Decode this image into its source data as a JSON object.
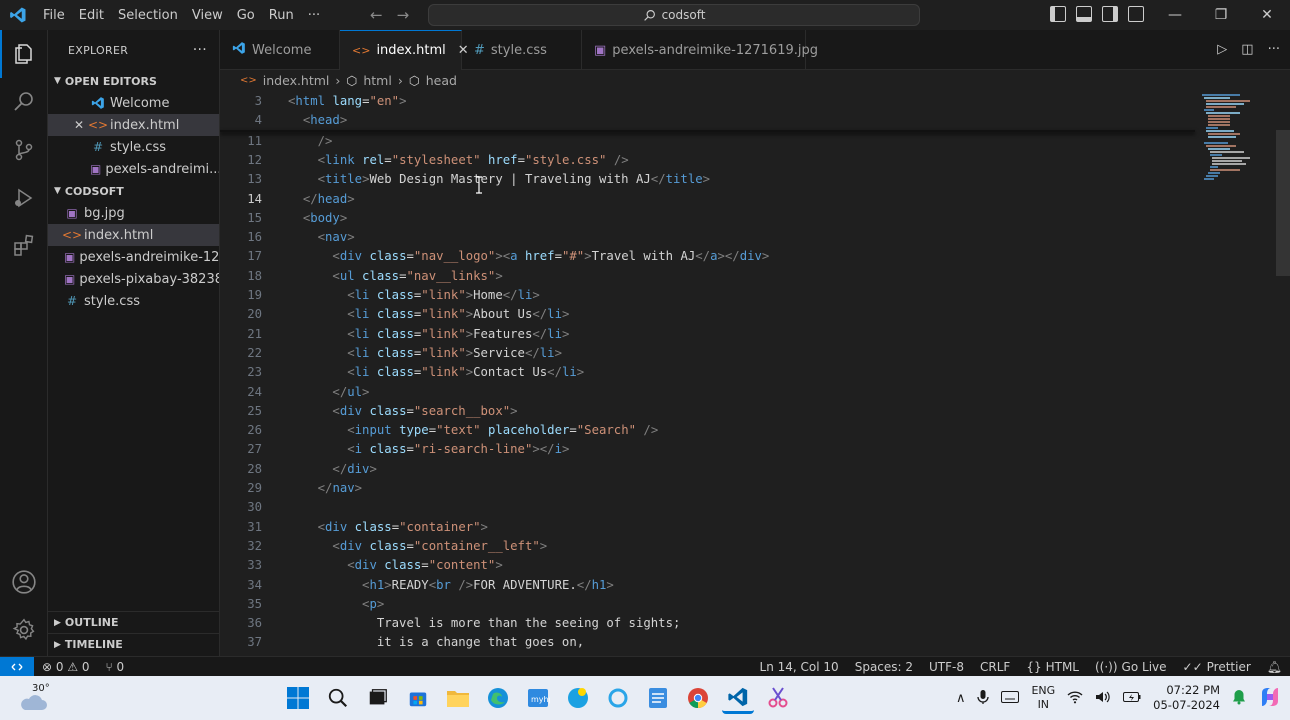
{
  "titlebar": {
    "menu": [
      "File",
      "Edit",
      "Selection",
      "View",
      "Go",
      "Run",
      "···"
    ],
    "search_text": "codsoft"
  },
  "explorer": {
    "title": "EXPLORER",
    "more": "···",
    "open_editors_label": "OPEN EDITORS",
    "open_editors": [
      {
        "label": "Welcome",
        "icon": "vscode-icon"
      },
      {
        "label": "index.html",
        "icon": "html-icon"
      },
      {
        "label": "style.css",
        "icon": "css-icon"
      },
      {
        "label": "pexels-andreimi...",
        "icon": "image-icon"
      }
    ],
    "close_glyph": "✕",
    "folder_label": "CODSOFT",
    "files": [
      {
        "label": "bg.jpg",
        "icon": "image-icon"
      },
      {
        "label": "index.html",
        "icon": "html-icon"
      },
      {
        "label": "pexels-andreimike-12...",
        "icon": "image-icon"
      },
      {
        "label": "pexels-pixabay-38238...",
        "icon": "image-icon"
      },
      {
        "label": "style.css",
        "icon": "css-icon"
      }
    ],
    "outline_label": "OUTLINE",
    "timeline_label": "TIMELINE"
  },
  "tabs": [
    {
      "label": "Welcome"
    },
    {
      "label": "index.html"
    },
    {
      "label": "style.css"
    },
    {
      "label": "pexels-andreimike-1271619.jpg"
    }
  ],
  "breadcrumb": [
    "index.html",
    "html",
    "head"
  ],
  "editor": {
    "sticky": [
      {
        "num": "3",
        "tokens": [
          [
            "br",
            "<"
          ],
          [
            "tag",
            "html"
          ],
          [
            "tx",
            " "
          ],
          [
            "at",
            "lang"
          ],
          [
            "tx",
            "="
          ],
          [
            "st",
            "\"en\""
          ],
          [
            "br",
            ">"
          ]
        ]
      },
      {
        "num": "4",
        "tokens": [
          [
            "tx",
            "  "
          ],
          [
            "br",
            "<"
          ],
          [
            "tag",
            "head"
          ],
          [
            "br",
            ">"
          ]
        ]
      }
    ],
    "lines": [
      {
        "num": "11",
        "tokens": [
          [
            "tx",
            "    "
          ],
          [
            "br",
            "/>"
          ]
        ]
      },
      {
        "num": "12",
        "tokens": [
          [
            "tx",
            "    "
          ],
          [
            "br",
            "<"
          ],
          [
            "tag",
            "link"
          ],
          [
            "tx",
            " "
          ],
          [
            "at",
            "rel"
          ],
          [
            "tx",
            "="
          ],
          [
            "st",
            "\"stylesheet\""
          ],
          [
            "tx",
            " "
          ],
          [
            "at",
            "href"
          ],
          [
            "tx",
            "="
          ],
          [
            "st",
            "\"style.css\""
          ],
          [
            "tx",
            " "
          ],
          [
            "br",
            "/>"
          ]
        ]
      },
      {
        "num": "13",
        "tokens": [
          [
            "tx",
            "    "
          ],
          [
            "br",
            "<"
          ],
          [
            "tag",
            "title"
          ],
          [
            "br",
            ">"
          ],
          [
            "tx",
            "Web Design Mastery | Traveling with AJ"
          ],
          [
            "br",
            "</"
          ],
          [
            "tag",
            "title"
          ],
          [
            "br",
            ">"
          ]
        ]
      },
      {
        "num": "14",
        "tokens": [
          [
            "tx",
            "  "
          ],
          [
            "br",
            "</"
          ],
          [
            "tag",
            "head"
          ],
          [
            "br",
            ">"
          ]
        ]
      },
      {
        "num": "15",
        "tokens": [
          [
            "tx",
            "  "
          ],
          [
            "br",
            "<"
          ],
          [
            "tag",
            "body"
          ],
          [
            "br",
            ">"
          ]
        ]
      },
      {
        "num": "16",
        "tokens": [
          [
            "tx",
            "    "
          ],
          [
            "br",
            "<"
          ],
          [
            "tag",
            "nav"
          ],
          [
            "br",
            ">"
          ]
        ]
      },
      {
        "num": "17",
        "tokens": [
          [
            "tx",
            "      "
          ],
          [
            "br",
            "<"
          ],
          [
            "tag",
            "div"
          ],
          [
            "tx",
            " "
          ],
          [
            "at",
            "class"
          ],
          [
            "tx",
            "="
          ],
          [
            "st",
            "\"nav__logo\""
          ],
          [
            "br",
            ">"
          ],
          [
            "br",
            "<"
          ],
          [
            "tag",
            "a"
          ],
          [
            "tx",
            " "
          ],
          [
            "at",
            "href"
          ],
          [
            "tx",
            "="
          ],
          [
            "st",
            "\"#\""
          ],
          [
            "br",
            ">"
          ],
          [
            "tx",
            "Travel with AJ"
          ],
          [
            "br",
            "</"
          ],
          [
            "tag",
            "a"
          ],
          [
            "br",
            ">"
          ],
          [
            "br",
            "</"
          ],
          [
            "tag",
            "div"
          ],
          [
            "br",
            ">"
          ]
        ]
      },
      {
        "num": "18",
        "tokens": [
          [
            "tx",
            "      "
          ],
          [
            "br",
            "<"
          ],
          [
            "tag",
            "ul"
          ],
          [
            "tx",
            " "
          ],
          [
            "at",
            "class"
          ],
          [
            "tx",
            "="
          ],
          [
            "st",
            "\"nav__links\""
          ],
          [
            "br",
            ">"
          ]
        ]
      },
      {
        "num": "19",
        "tokens": [
          [
            "tx",
            "        "
          ],
          [
            "br",
            "<"
          ],
          [
            "tag",
            "li"
          ],
          [
            "tx",
            " "
          ],
          [
            "at",
            "class"
          ],
          [
            "tx",
            "="
          ],
          [
            "st",
            "\"link\""
          ],
          [
            "br",
            ">"
          ],
          [
            "tx",
            "Home"
          ],
          [
            "br",
            "</"
          ],
          [
            "tag",
            "li"
          ],
          [
            "br",
            ">"
          ]
        ]
      },
      {
        "num": "20",
        "tokens": [
          [
            "tx",
            "        "
          ],
          [
            "br",
            "<"
          ],
          [
            "tag",
            "li"
          ],
          [
            "tx",
            " "
          ],
          [
            "at",
            "class"
          ],
          [
            "tx",
            "="
          ],
          [
            "st",
            "\"link\""
          ],
          [
            "br",
            ">"
          ],
          [
            "tx",
            "About Us"
          ],
          [
            "br",
            "</"
          ],
          [
            "tag",
            "li"
          ],
          [
            "br",
            ">"
          ]
        ]
      },
      {
        "num": "21",
        "tokens": [
          [
            "tx",
            "        "
          ],
          [
            "br",
            "<"
          ],
          [
            "tag",
            "li"
          ],
          [
            "tx",
            " "
          ],
          [
            "at",
            "class"
          ],
          [
            "tx",
            "="
          ],
          [
            "st",
            "\"link\""
          ],
          [
            "br",
            ">"
          ],
          [
            "tx",
            "Features"
          ],
          [
            "br",
            "</"
          ],
          [
            "tag",
            "li"
          ],
          [
            "br",
            ">"
          ]
        ]
      },
      {
        "num": "22",
        "tokens": [
          [
            "tx",
            "        "
          ],
          [
            "br",
            "<"
          ],
          [
            "tag",
            "li"
          ],
          [
            "tx",
            " "
          ],
          [
            "at",
            "class"
          ],
          [
            "tx",
            "="
          ],
          [
            "st",
            "\"link\""
          ],
          [
            "br",
            ">"
          ],
          [
            "tx",
            "Service"
          ],
          [
            "br",
            "</"
          ],
          [
            "tag",
            "li"
          ],
          [
            "br",
            ">"
          ]
        ]
      },
      {
        "num": "23",
        "tokens": [
          [
            "tx",
            "        "
          ],
          [
            "br",
            "<"
          ],
          [
            "tag",
            "li"
          ],
          [
            "tx",
            " "
          ],
          [
            "at",
            "class"
          ],
          [
            "tx",
            "="
          ],
          [
            "st",
            "\"link\""
          ],
          [
            "br",
            ">"
          ],
          [
            "tx",
            "Contact Us"
          ],
          [
            "br",
            "</"
          ],
          [
            "tag",
            "li"
          ],
          [
            "br",
            ">"
          ]
        ]
      },
      {
        "num": "24",
        "tokens": [
          [
            "tx",
            "      "
          ],
          [
            "br",
            "</"
          ],
          [
            "tag",
            "ul"
          ],
          [
            "br",
            ">"
          ]
        ]
      },
      {
        "num": "25",
        "tokens": [
          [
            "tx",
            "      "
          ],
          [
            "br",
            "<"
          ],
          [
            "tag",
            "div"
          ],
          [
            "tx",
            " "
          ],
          [
            "at",
            "class"
          ],
          [
            "tx",
            "="
          ],
          [
            "st",
            "\"search__box\""
          ],
          [
            "br",
            ">"
          ]
        ]
      },
      {
        "num": "26",
        "tokens": [
          [
            "tx",
            "        "
          ],
          [
            "br",
            "<"
          ],
          [
            "tag",
            "input"
          ],
          [
            "tx",
            " "
          ],
          [
            "at",
            "type"
          ],
          [
            "tx",
            "="
          ],
          [
            "st",
            "\"text\""
          ],
          [
            "tx",
            " "
          ],
          [
            "at",
            "placeholder"
          ],
          [
            "tx",
            "="
          ],
          [
            "st",
            "\"Search\""
          ],
          [
            "tx",
            " "
          ],
          [
            "br",
            "/>"
          ]
        ]
      },
      {
        "num": "27",
        "tokens": [
          [
            "tx",
            "        "
          ],
          [
            "br",
            "<"
          ],
          [
            "tag",
            "i"
          ],
          [
            "tx",
            " "
          ],
          [
            "at",
            "class"
          ],
          [
            "tx",
            "="
          ],
          [
            "st",
            "\"ri-search-line\""
          ],
          [
            "br",
            "></"
          ],
          [
            "tag",
            "i"
          ],
          [
            "br",
            ">"
          ]
        ]
      },
      {
        "num": "28",
        "tokens": [
          [
            "tx",
            "      "
          ],
          [
            "br",
            "</"
          ],
          [
            "tag",
            "div"
          ],
          [
            "br",
            ">"
          ]
        ]
      },
      {
        "num": "29",
        "tokens": [
          [
            "tx",
            "    "
          ],
          [
            "br",
            "</"
          ],
          [
            "tag",
            "nav"
          ],
          [
            "br",
            ">"
          ]
        ]
      },
      {
        "num": "30",
        "tokens": []
      },
      {
        "num": "31",
        "tokens": [
          [
            "tx",
            "    "
          ],
          [
            "br",
            "<"
          ],
          [
            "tag",
            "div"
          ],
          [
            "tx",
            " "
          ],
          [
            "at",
            "class"
          ],
          [
            "tx",
            "="
          ],
          [
            "st",
            "\"container\""
          ],
          [
            "br",
            ">"
          ]
        ]
      },
      {
        "num": "32",
        "tokens": [
          [
            "tx",
            "      "
          ],
          [
            "br",
            "<"
          ],
          [
            "tag",
            "div"
          ],
          [
            "tx",
            " "
          ],
          [
            "at",
            "class"
          ],
          [
            "tx",
            "="
          ],
          [
            "st",
            "\"container__left\""
          ],
          [
            "br",
            ">"
          ]
        ]
      },
      {
        "num": "33",
        "tokens": [
          [
            "tx",
            "        "
          ],
          [
            "br",
            "<"
          ],
          [
            "tag",
            "div"
          ],
          [
            "tx",
            " "
          ],
          [
            "at",
            "class"
          ],
          [
            "tx",
            "="
          ],
          [
            "st",
            "\"content\""
          ],
          [
            "br",
            ">"
          ]
        ]
      },
      {
        "num": "34",
        "tokens": [
          [
            "tx",
            "          "
          ],
          [
            "br",
            "<"
          ],
          [
            "tag",
            "h1"
          ],
          [
            "br",
            ">"
          ],
          [
            "tx",
            "READY"
          ],
          [
            "br",
            "<"
          ],
          [
            "tag",
            "br"
          ],
          [
            "tx",
            " "
          ],
          [
            "br",
            "/>"
          ],
          [
            "tx",
            "FOR ADVENTURE."
          ],
          [
            "br",
            "</"
          ],
          [
            "tag",
            "h1"
          ],
          [
            "br",
            ">"
          ]
        ]
      },
      {
        "num": "35",
        "tokens": [
          [
            "tx",
            "          "
          ],
          [
            "br",
            "<"
          ],
          [
            "tag",
            "p"
          ],
          [
            "br",
            ">"
          ]
        ]
      },
      {
        "num": "36",
        "tokens": [
          [
            "tx",
            "            Travel is more than the seeing of sights;"
          ]
        ]
      },
      {
        "num": "37",
        "tokens": [
          [
            "tx",
            "            it is a change that goes on,"
          ]
        ]
      }
    ],
    "current_line": "14"
  },
  "statusbar": {
    "problems": "⊗ 0 ⚠ 0",
    "ports": "⑂ 0",
    "position": "Ln 14, Col 10",
    "spaces": "Spaces: 2",
    "encoding": "UTF-8",
    "eol": "CRLF",
    "language": "HTML",
    "golive": "Go Live",
    "prettier": "Prettier"
  },
  "taskbar": {
    "weather_temp": "30°",
    "lang_top": "ENG",
    "lang_bottom": "IN",
    "time": "07:22 PM",
    "date": "05-07-2024"
  },
  "colors": {
    "accent": "#0078d4",
    "tag": "#569cd6",
    "attr": "#9cdcfe",
    "string": "#ce9178"
  }
}
